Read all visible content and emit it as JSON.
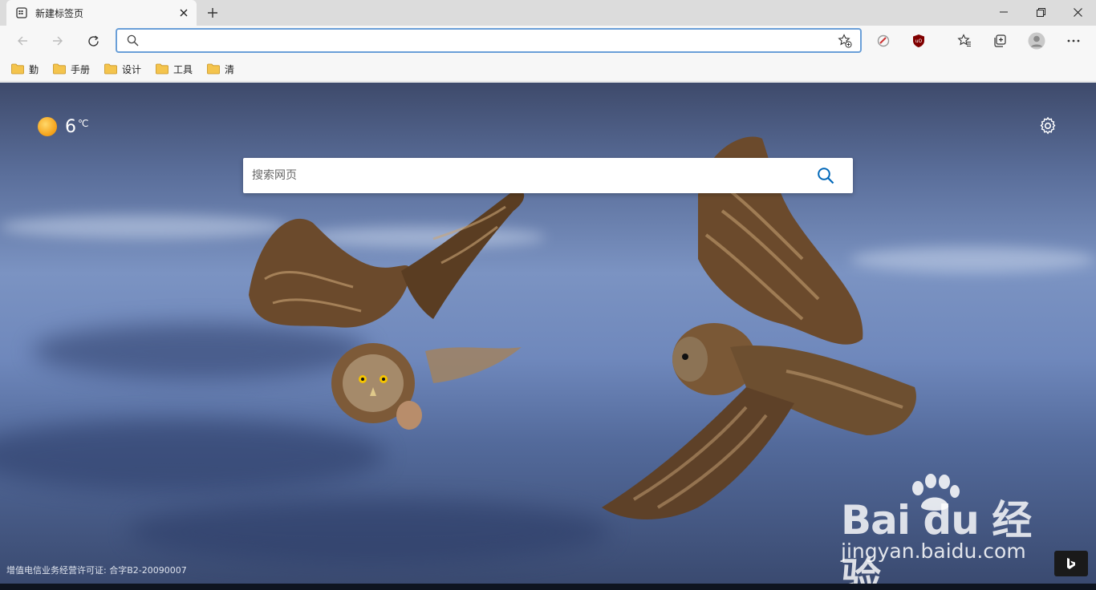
{
  "tab": {
    "title": "新建标签页",
    "favicon": "newtab-page-icon",
    "close_icon": "close-icon"
  },
  "new_tab_icon": "plus-icon",
  "window_controls": [
    "minimize-icon",
    "restore-icon",
    "close-icon"
  ],
  "toolbar": {
    "back_icon": "back-arrow-icon",
    "forward_icon": "forward-arrow-icon",
    "refresh_icon": "refresh-icon",
    "address": {
      "value": "",
      "placeholder": ""
    },
    "extensions": [
      "extension-icon",
      "ublock-icon"
    ],
    "favorites_icon": "favorites-icon",
    "collections_icon": "collections-icon",
    "profile_icon": "profile-avatar-icon",
    "more_icon": "more-icon"
  },
  "bookmarks": [
    {
      "label": "勤"
    },
    {
      "label": "手册"
    },
    {
      "label": "设计"
    },
    {
      "label": "工具"
    },
    {
      "label": "清"
    }
  ],
  "weather": {
    "temp": "6",
    "unit": "℃",
    "icon": "sun-icon"
  },
  "search": {
    "placeholder": "搜索网页"
  },
  "license": "增值电信业务经营许可证: 合字B2-20090007",
  "watermark": {
    "brand": "Bai du 经验",
    "sub": "jingyan.baidu.com"
  },
  "colors": {
    "accent": "#0067b8",
    "address_border": "#6a9fd8"
  }
}
